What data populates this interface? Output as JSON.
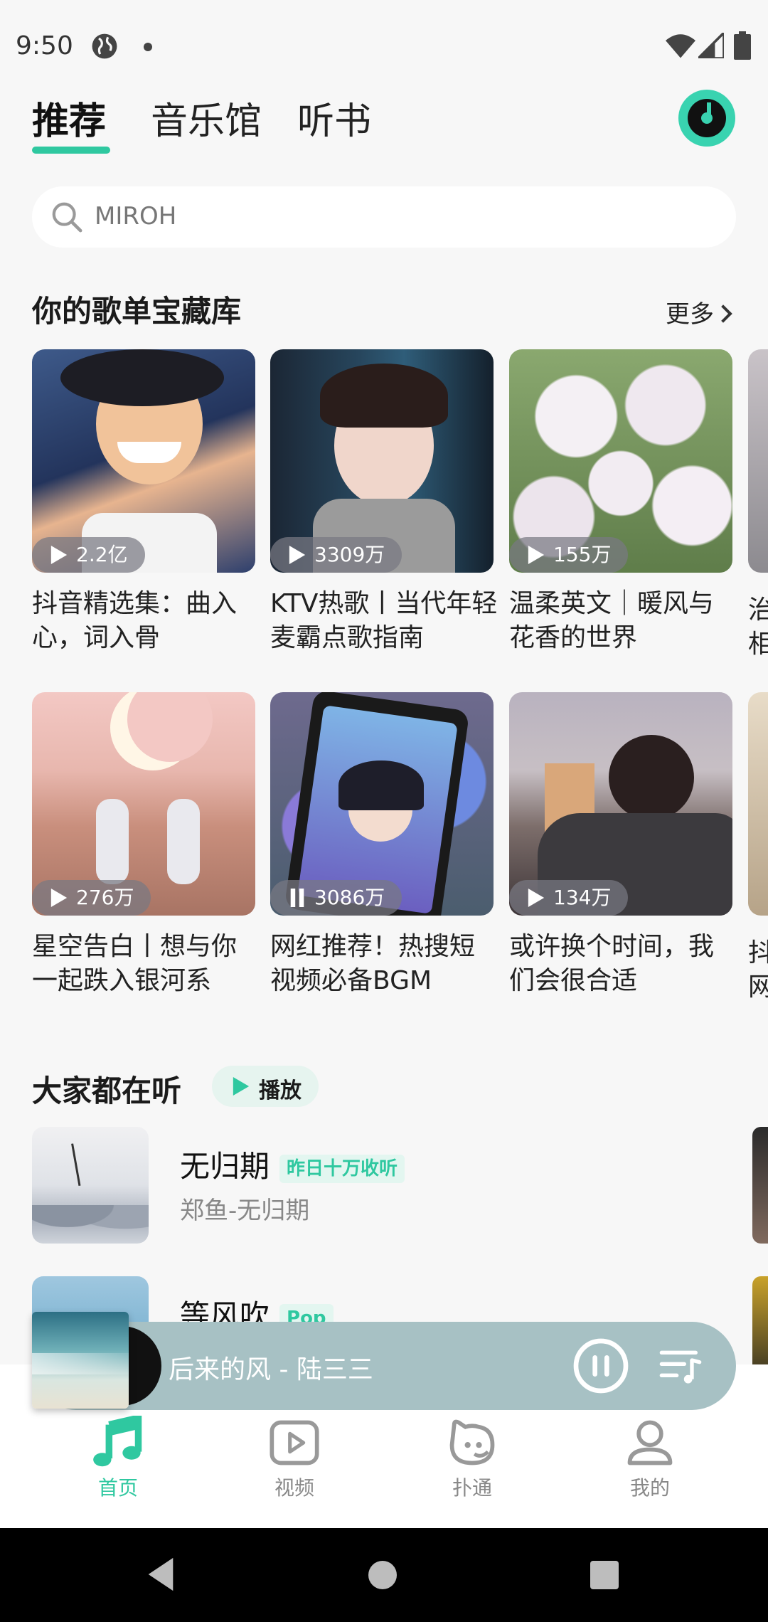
{
  "status_bar": {
    "time": "9:50"
  },
  "tabs": [
    {
      "label": "推荐",
      "active": true
    },
    {
      "label": "音乐馆",
      "active": false
    },
    {
      "label": "听书",
      "active": false
    }
  ],
  "search": {
    "text": "MIROH"
  },
  "playlists_section": {
    "title": "你的歌单宝藏库",
    "more_label": "更多",
    "cards": [
      {
        "count": "2.2亿",
        "title": "抖音精选集：曲入心，词入骨",
        "state": "play"
      },
      {
        "count": "3309万",
        "title": "KTV热歌丨当代年轻麦霸点歌指南",
        "state": "play"
      },
      {
        "count": "155万",
        "title": "温柔英文｜暖风与花香的世界",
        "state": "play"
      },
      {
        "count": "276万",
        "title": "星空告白丨想与你一起跌入银河系",
        "state": "play"
      },
      {
        "count": "3086万",
        "title": "网红推荐！热搜短视频必备BGM",
        "state": "paused"
      },
      {
        "count": "134万",
        "title": "或许换个时间，我们会很合适",
        "state": "play"
      }
    ],
    "peek_text_row1": "治\n相",
    "peek_text_row2": "抖\n网"
  },
  "popular_section": {
    "title": "大家都在听",
    "play_label": "播放",
    "songs": [
      {
        "name": "无归期",
        "tag": "昨日十万收听",
        "sub": "郑鱼-无归期"
      },
      {
        "name": "等风吹",
        "tag": "Pop",
        "sub": ""
      }
    ]
  },
  "mini_player": {
    "title": "后来的风 - 陆三三"
  },
  "bottom_nav": [
    {
      "label": "首页",
      "icon": "music-note-icon",
      "active": true
    },
    {
      "label": "视频",
      "icon": "video-icon",
      "active": false
    },
    {
      "label": "扑通",
      "icon": "chat-face-icon",
      "active": false
    },
    {
      "label": "我的",
      "icon": "person-icon",
      "active": false
    }
  ],
  "colors": {
    "accent": "#2fc8a0",
    "background": "#f7f7f7",
    "player_bg": "#a7c1c4"
  }
}
